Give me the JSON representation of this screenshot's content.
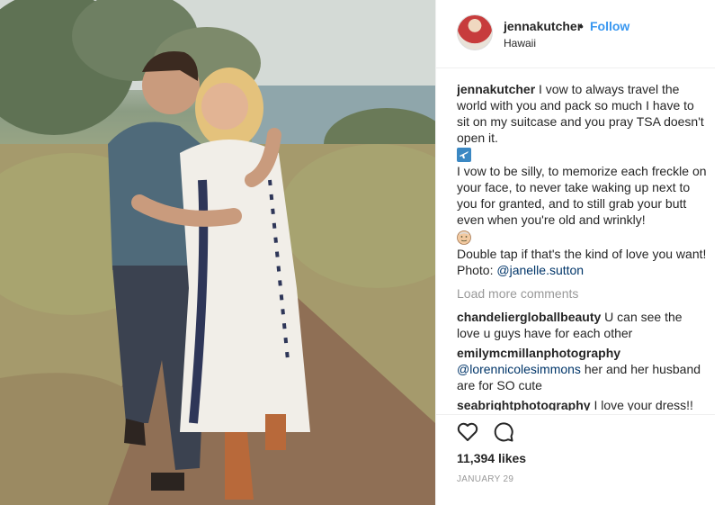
{
  "header": {
    "username": "jennakutcher",
    "separator": "•",
    "follow_label": "Follow",
    "location": "Hawaii"
  },
  "caption": {
    "username": "jennakutcher",
    "line1": "I vow to always travel the world with you and pack so much I have to sit on my suitcase and you pray TSA doesn't open it.",
    "emoji1": "airplane-emoji",
    "line2": "I vow to be silly, to memorize each freckle on your face, to never take waking up next to you for granted, and to still grab your butt even when you're old and wrinkly!",
    "emoji2": "older-face-emoji",
    "line3": "Double tap if that's the kind of love you want! Photo:",
    "mention": "@janelle.sutton"
  },
  "load_more_label": "Load more comments",
  "comments": [
    {
      "username": "chandeliergloballbeauty",
      "text": "U can see the love u guys have for each other"
    },
    {
      "username": "emilymcmillanphotography",
      "mention": "@lorennicolesimmons",
      "text": "her and her husband are for SO cute"
    },
    {
      "username": "seabrightphotography",
      "text": "I love your dress!!"
    }
  ],
  "actions": {
    "like_icon": "heart-outline-icon",
    "comment_icon": "comment-bubble-icon",
    "likes": "11,394 likes",
    "date": "JANUARY 29"
  },
  "colors": {
    "link_blue": "#3897f0",
    "mention_blue": "#003569",
    "muted": "#999999",
    "text": "#262626",
    "divider": "#efefef"
  }
}
